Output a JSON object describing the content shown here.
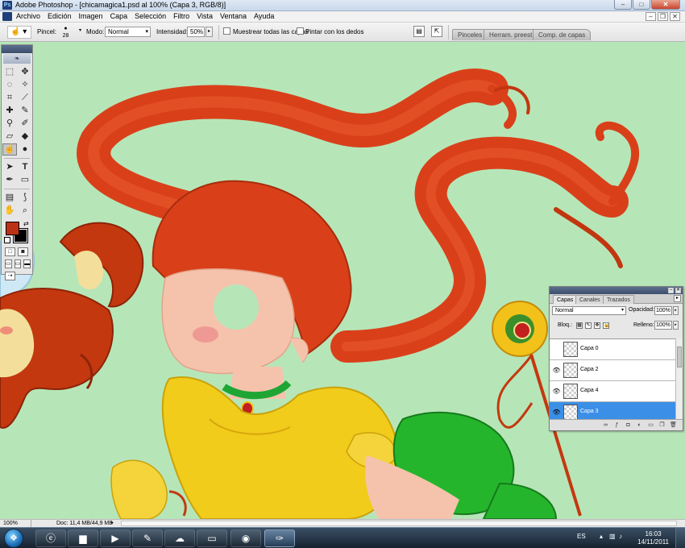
{
  "window": {
    "title": "Adobe Photoshop - [chicamagica1.psd al 100% (Capa 3, RGB/8)]",
    "app_icon": "ps-logo-icon",
    "controls": [
      "minimize-icon",
      "maximize-icon",
      "close-icon"
    ]
  },
  "menubar": {
    "items": [
      "Archivo",
      "Edición",
      "Imagen",
      "Capa",
      "Selección",
      "Filtro",
      "Vista",
      "Ventana",
      "Ayuda"
    ]
  },
  "options": {
    "brush_label": "Pincel:",
    "brush_size": "28",
    "mode_label": "Modo:",
    "mode_value": "Normal",
    "intensity_label": "Intensidad:",
    "intensity_value": "50%",
    "sample_all_label": "Muestrear todas las capas",
    "finger_paint_label": "Pintar con los dedos",
    "sample_all_checked": false,
    "finger_paint_checked": false,
    "well_tabs": [
      "Pinceles",
      "Herram. preest.",
      "Comp. de capas"
    ]
  },
  "toolbox": {
    "active_tool": "smudge-tool",
    "foreground_color": "#bb3114",
    "background_color": "#000000"
  },
  "layers_panel": {
    "tabs": [
      "Capas",
      "Canales",
      "Trazados"
    ],
    "active_tab": "Capas",
    "blend_mode": "Normal",
    "opacity_label": "Opacidad:",
    "opacity_value": "100%",
    "lock_label": "Bloq.:",
    "fill_label": "Relleno:",
    "fill_value": "100%",
    "layers": [
      {
        "name": "Capa 0",
        "visible": false,
        "selected": false
      },
      {
        "name": "Capa 2",
        "visible": true,
        "selected": false
      },
      {
        "name": "Capa 4",
        "visible": true,
        "selected": false
      },
      {
        "name": "Capa 3",
        "visible": true,
        "selected": true
      }
    ]
  },
  "statusbar": {
    "zoom": "100%",
    "doc_info": "Doc: 11,4 MB/44,9 MB"
  },
  "taskbar": {
    "language": "ES",
    "time": "16:03",
    "date": "14/11/2011",
    "apps": [
      "internet-explorer-icon",
      "folder-icon",
      "media-player-icon",
      "tool-app-icon",
      "network-app-icon",
      "window-app-icon",
      "chrome-icon",
      "photoshop-icon"
    ],
    "active_app": "photoshop-icon"
  },
  "artwork": {
    "hair_color": "#d9401a",
    "skin_color": "#f5c3ac",
    "dress_color": "#f1cc1a",
    "bow_color": "#25b52c"
  }
}
